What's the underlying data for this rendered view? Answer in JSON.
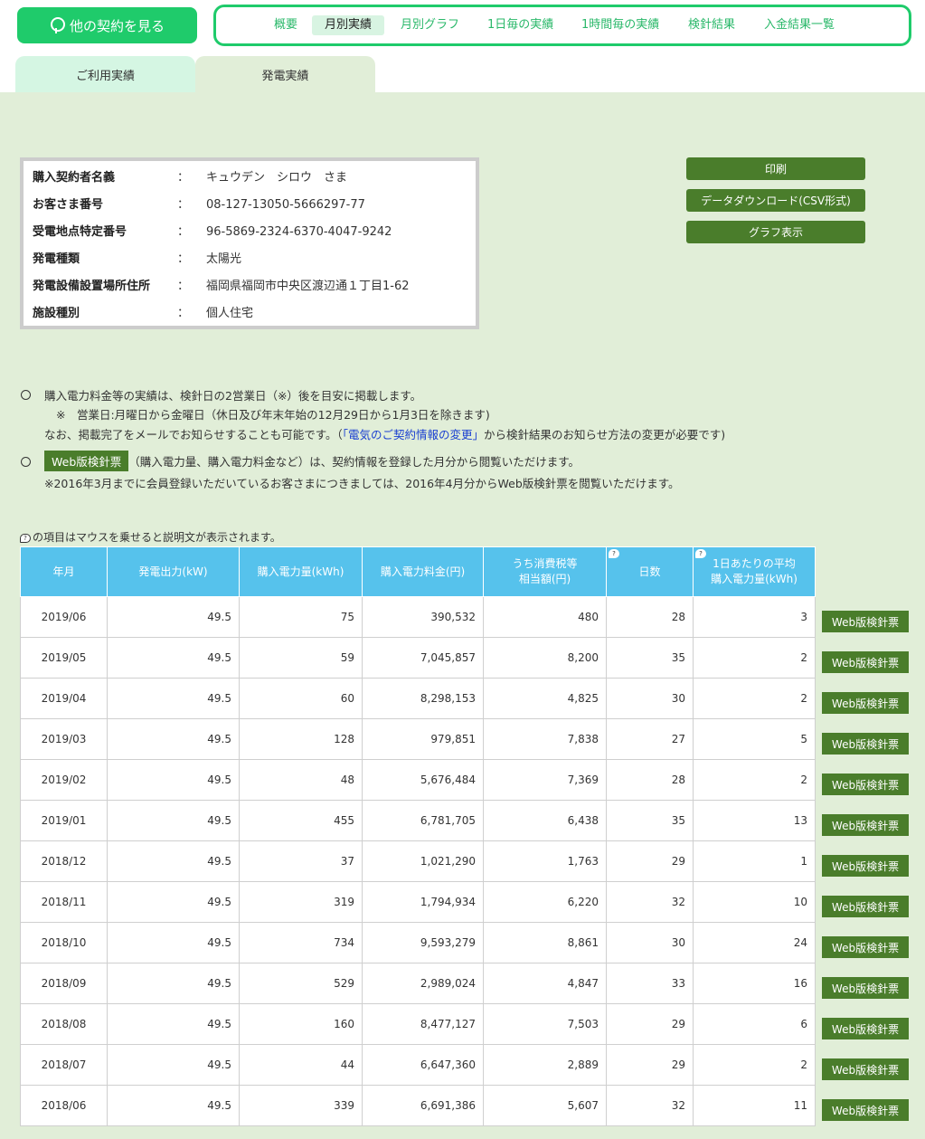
{
  "top_button": {
    "label": "他の契約を見る"
  },
  "nav": {
    "items": [
      {
        "label": "概要"
      },
      {
        "label": "月別実績"
      },
      {
        "label": "月別グラフ"
      },
      {
        "label": "1日毎の実績"
      },
      {
        "label": "1時間毎の実績"
      },
      {
        "label": "検針結果"
      },
      {
        "label": "入金結果一覧"
      }
    ]
  },
  "tabs": [
    {
      "label": "ご利用実績"
    },
    {
      "label": "発電実績"
    }
  ],
  "info": {
    "colon": "：",
    "rows": [
      {
        "label": "購入契約者名義",
        "value": "キュウデン　シロウ　さま"
      },
      {
        "label": "お客さま番号",
        "value": "08-127-13050-5666297-77"
      },
      {
        "label": "受電地点特定番号",
        "value": "96-5869-2324-6370-4047-9242"
      },
      {
        "label": "発電種類",
        "value": "太陽光"
      },
      {
        "label": "発電設備設置場所住所",
        "value": "福岡県福岡市中央区渡辺通１丁目1-62"
      },
      {
        "label": "施設種別",
        "value": "個人住宅"
      }
    ]
  },
  "actions": {
    "print": "印刷",
    "download": "データダウンロード(CSV形式)",
    "graph": "グラフ表示"
  },
  "notes": {
    "line1": "購入電力料金等の実績は、検針日の2営業日（※）後を目安に掲載します。",
    "line2": "※　営業日:月曜日から金曜日（休日及び年末年始の12月29日から1月3日を除きます)",
    "line3_pre": "なお、掲載完了をメールでお知らせすることも可能です。（",
    "line3_link": "「電気のご契約情報の変更」",
    "line3_post": "から検針結果のお知らせ方法の変更が必要です)",
    "web_tag": "Web版検針票",
    "line4_post": "（購入電力量、購入電力料金など）は、契約情報を登録した月分から閲覧いただけます。",
    "line5": "※2016年3月までに会員登録いただいているお客さまにつきましては、2016年4月分からWeb版検針票を閲覧いただけます。"
  },
  "help_text": "の項目はマウスを乗せると説明文が表示されます。",
  "help_icon": "?",
  "table": {
    "headers": [
      "年月",
      "発電出力(kW)",
      "購入電力量(kWh)",
      "購入電力料金(円)",
      "うち消費税等\n相当額(円)",
      "日数",
      "1日あたりの平均\n購入電力量(kWh)"
    ],
    "row_button": "Web版検針票",
    "rows": [
      [
        "2019/06",
        "49.5",
        "75",
        "390,532",
        "480",
        "28",
        "3"
      ],
      [
        "2019/05",
        "49.5",
        "59",
        "7,045,857",
        "8,200",
        "35",
        "2"
      ],
      [
        "2019/04",
        "49.5",
        "60",
        "8,298,153",
        "4,825",
        "30",
        "2"
      ],
      [
        "2019/03",
        "49.5",
        "128",
        "979,851",
        "7,838",
        "27",
        "5"
      ],
      [
        "2019/02",
        "49.5",
        "48",
        "5,676,484",
        "7,369",
        "28",
        "2"
      ],
      [
        "2019/01",
        "49.5",
        "455",
        "6,781,705",
        "6,438",
        "35",
        "13"
      ],
      [
        "2018/12",
        "49.5",
        "37",
        "1,021,290",
        "1,763",
        "29",
        "1"
      ],
      [
        "2018/11",
        "49.5",
        "319",
        "1,794,934",
        "6,220",
        "32",
        "10"
      ],
      [
        "2018/10",
        "49.5",
        "734",
        "9,593,279",
        "8,861",
        "30",
        "24"
      ],
      [
        "2018/09",
        "49.5",
        "529",
        "2,989,024",
        "4,847",
        "33",
        "16"
      ],
      [
        "2018/08",
        "49.5",
        "160",
        "8,477,127",
        "7,503",
        "29",
        "6"
      ],
      [
        "2018/07",
        "49.5",
        "44",
        "6,647,360",
        "2,889",
        "29",
        "2"
      ],
      [
        "2018/06",
        "49.5",
        "339",
        "6,691,386",
        "5,607",
        "32",
        "11"
      ]
    ]
  }
}
